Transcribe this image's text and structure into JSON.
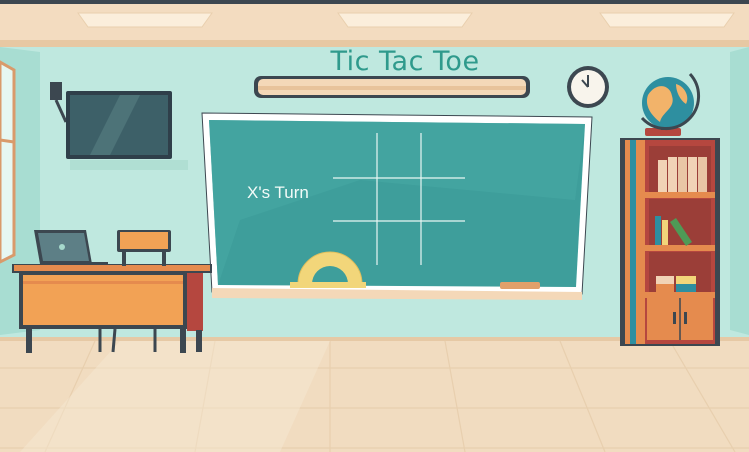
{
  "game": {
    "title": "Tic Tac Toe",
    "status": "X's Turn",
    "current_player": "X",
    "board": [
      "",
      "",
      "",
      "",
      "",
      "",
      "",
      "",
      ""
    ]
  },
  "colors": {
    "wall": "#bfe8df",
    "chalkboard": "#3e9e9b",
    "chalk": "#e8f6f2",
    "title": "#2f9a8c",
    "floor": "#f1dcc0"
  },
  "icons": [
    "tv-icon",
    "clock-icon",
    "globe-icon",
    "laptop-icon",
    "protractor-icon"
  ]
}
